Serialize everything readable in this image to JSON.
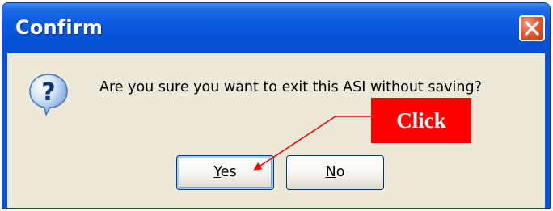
{
  "dialog": {
    "title": "Confirm",
    "message": "Are you sure you want to exit this ASI without saving?",
    "icon": "question-icon",
    "buttons": {
      "yes": {
        "mnemonic": "Y",
        "rest": "es"
      },
      "no": {
        "mnemonic": "N",
        "rest": "o"
      }
    }
  },
  "annotation": {
    "label": "Click",
    "color": "#ff0000"
  },
  "colors": {
    "titlebar": "#0a52d8",
    "client": "#ece9d8",
    "close": "#e4582e"
  }
}
